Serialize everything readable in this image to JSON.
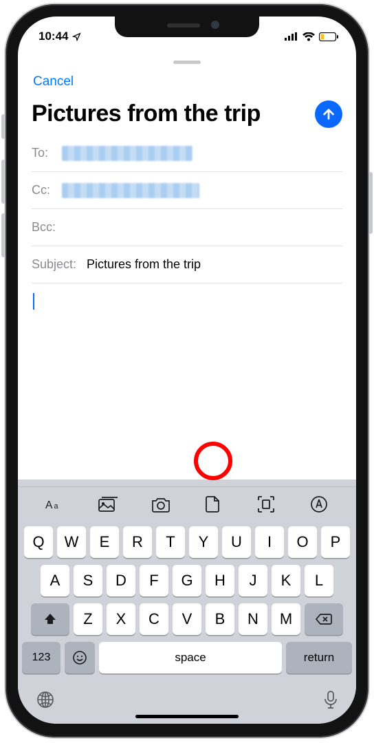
{
  "status": {
    "time": "10:44"
  },
  "compose": {
    "cancel": "Cancel",
    "subject_display": "Pictures from the trip",
    "to_label": "To:",
    "cc_label": "Cc:",
    "bcc_label": "Bcc:",
    "subject_label": "Subject:",
    "subject_value": "Pictures from the trip"
  },
  "keyboard": {
    "row1": [
      "Q",
      "W",
      "E",
      "R",
      "T",
      "Y",
      "U",
      "I",
      "O",
      "P"
    ],
    "row2": [
      "A",
      "S",
      "D",
      "F",
      "G",
      "H",
      "J",
      "K",
      "L"
    ],
    "row3": [
      "Z",
      "X",
      "C",
      "V",
      "B",
      "N",
      "M"
    ],
    "numbers": "123",
    "space": "space",
    "return": "return"
  }
}
